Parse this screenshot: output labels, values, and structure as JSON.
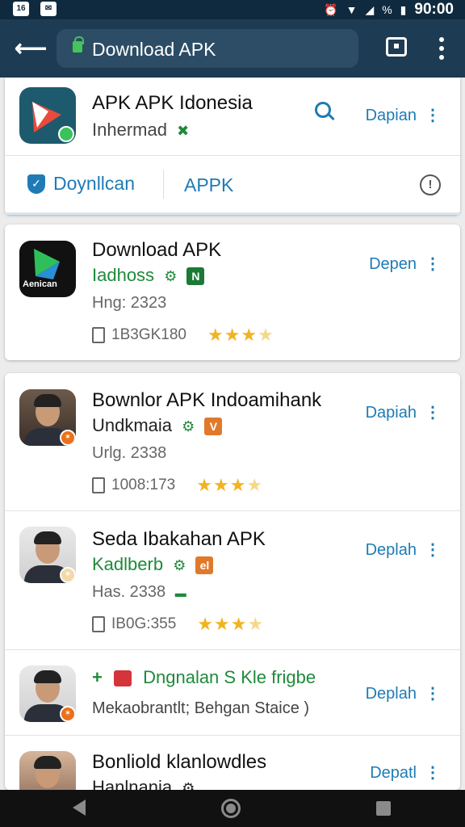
{
  "status_bar": {
    "left_icons": [
      "notification-icon",
      "message-icon"
    ],
    "signal_text": "%",
    "time": "90:00"
  },
  "toolbar": {
    "url": "Download APK"
  },
  "header_card": {
    "title": "APK APK Idonesia",
    "developer": "Inhermad",
    "action": "Dapian",
    "tab_verified": "Doynllcan",
    "tab_apk": "APPK"
  },
  "featured": {
    "title": "Download APK",
    "developer": "Iadhoss",
    "tag": "N",
    "meta": "Hng: 2323",
    "size": "1B3GK180",
    "action": "Depen",
    "icon_text": "Aenican"
  },
  "list": [
    {
      "title": "Bownlor APK Indoamihank",
      "developer": "Undkmaia",
      "tag": "V",
      "meta": "Urlg. 2338",
      "size": "1008:173",
      "action": "Dapiah"
    },
    {
      "title": "Seda Ibakahan APK",
      "developer": "Kadlberb",
      "tag": "el",
      "meta": "Has. 2338",
      "size": "IB0G:355",
      "action": "Deplah"
    },
    {
      "title": "Dngnalan S Kle frigbe",
      "developer": "Mekaobrantlt; Behgan Staice )",
      "action": "Deplah"
    },
    {
      "title": "Bonliold klanlowdles",
      "developer": "Hanlnania",
      "action": "Depatl"
    }
  ]
}
